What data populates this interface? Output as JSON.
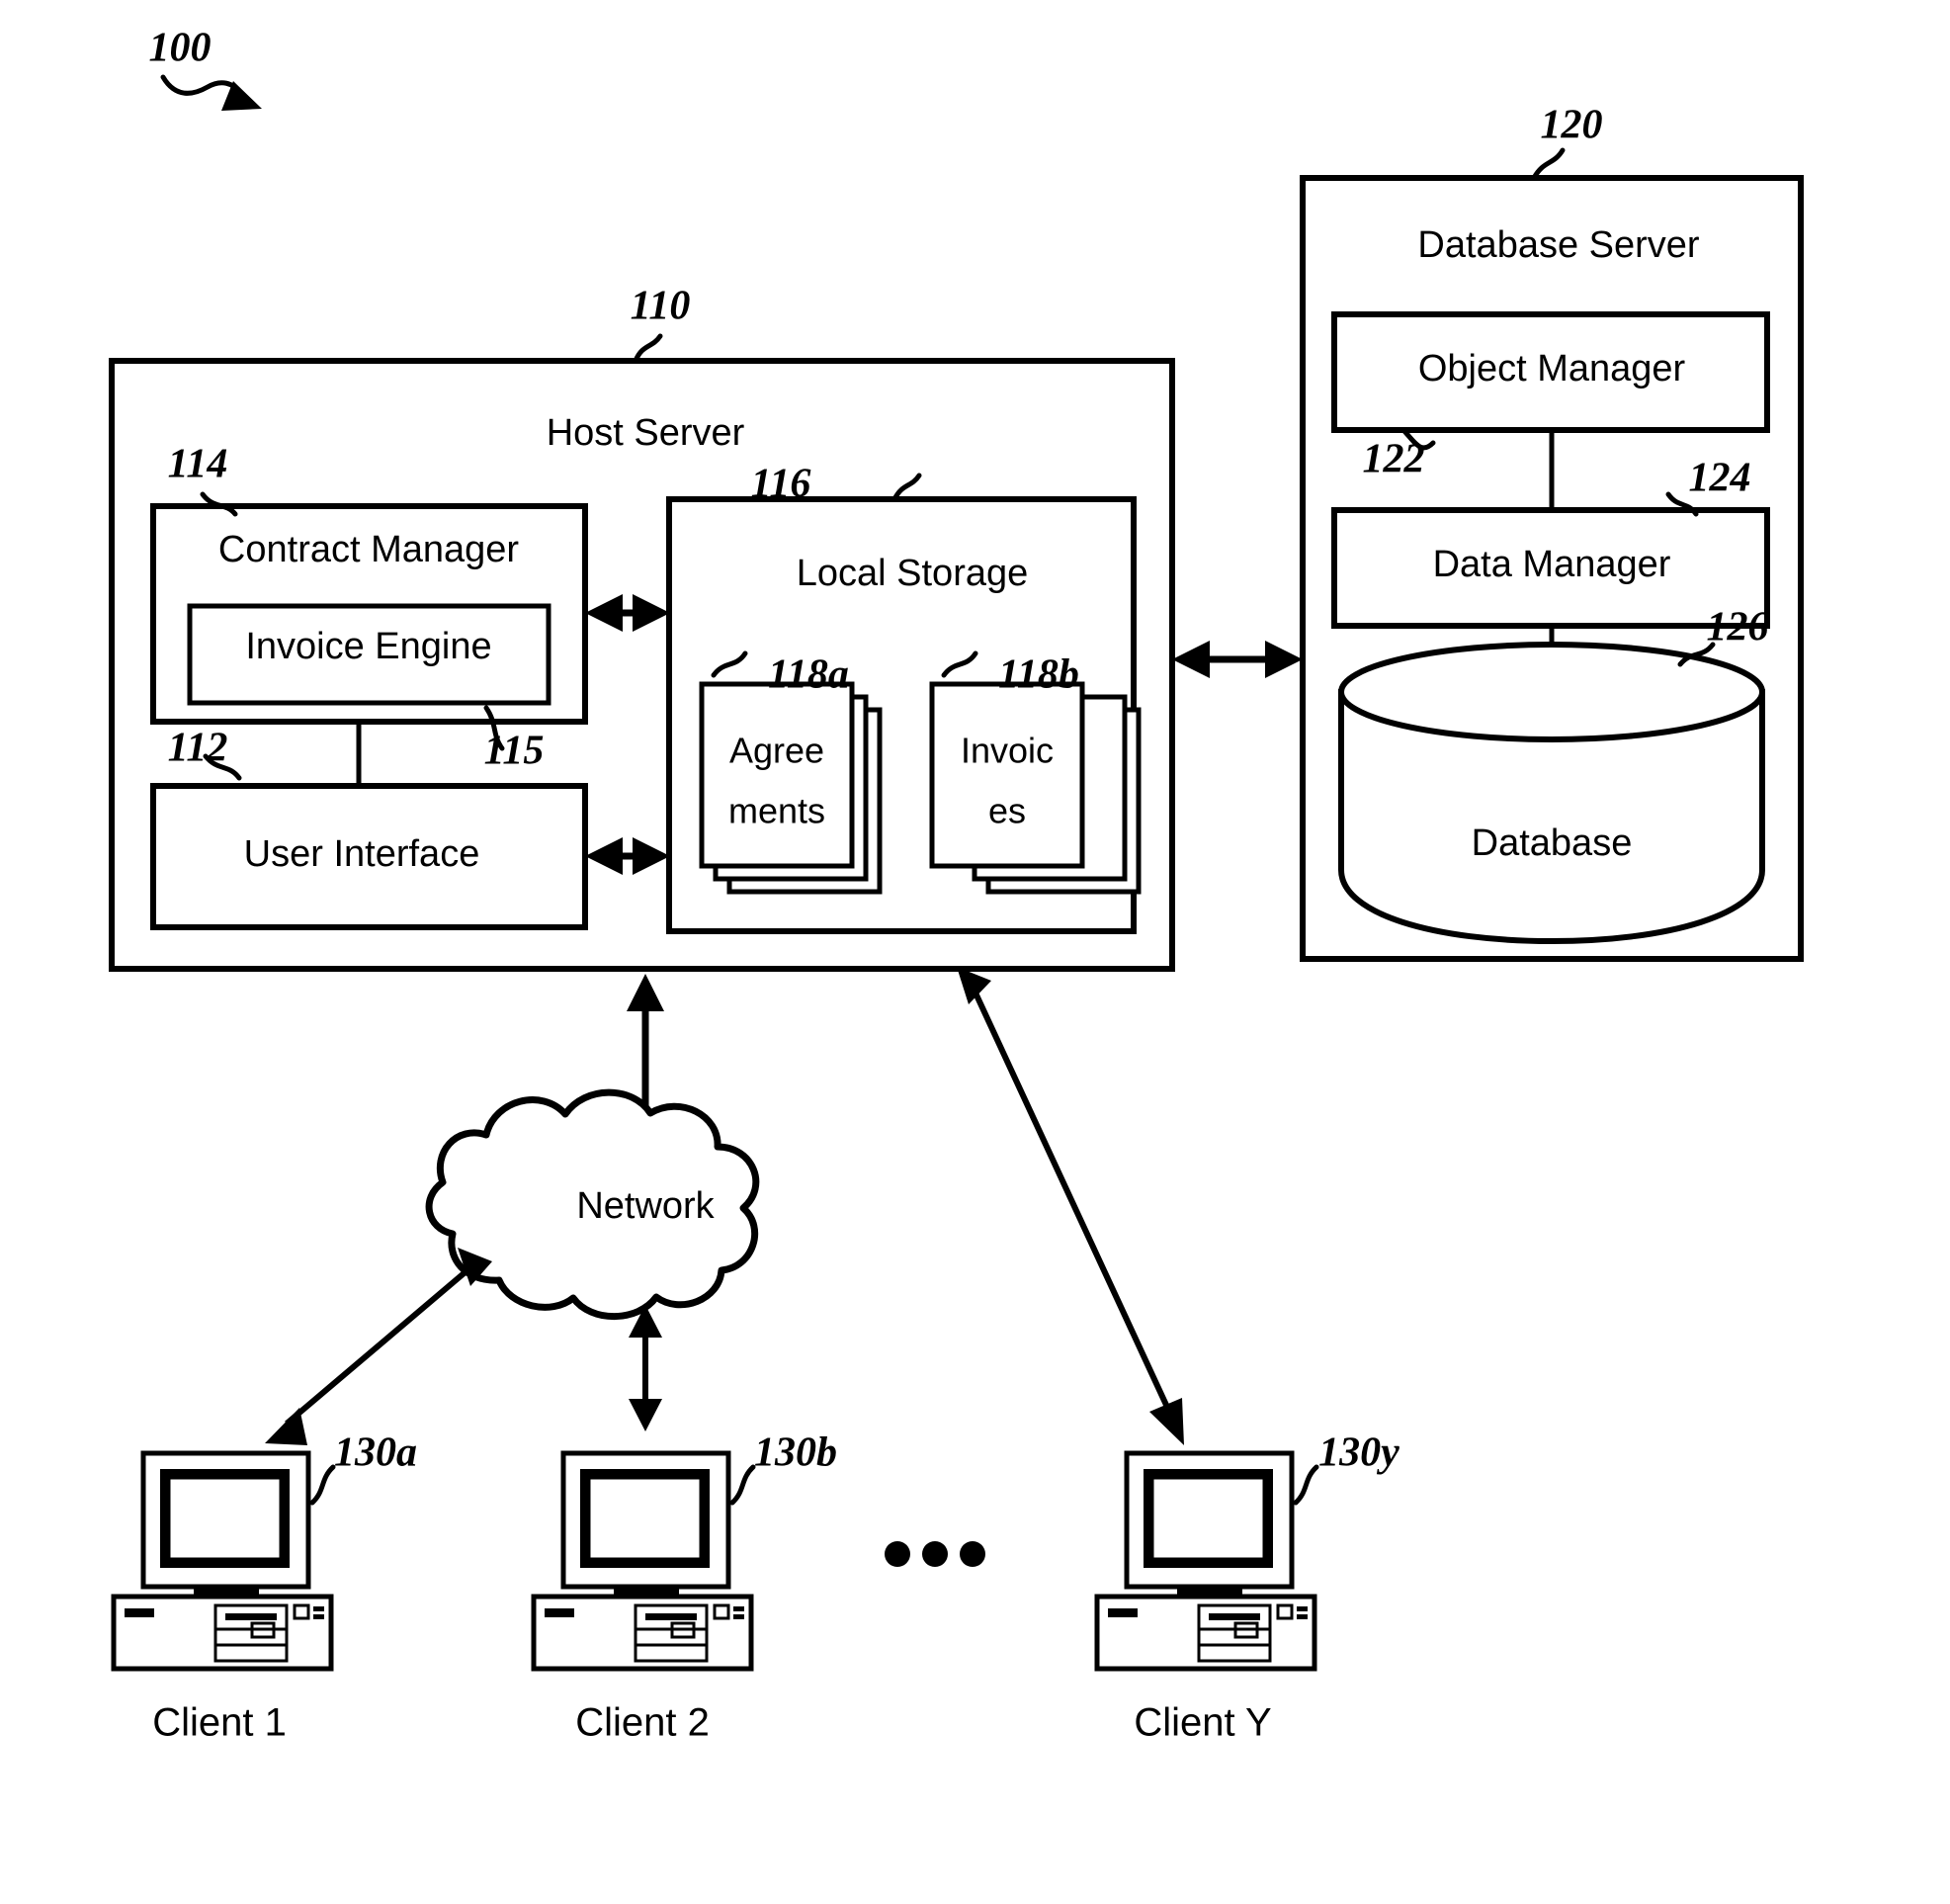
{
  "figure": {
    "reference_number": "100",
    "host_server": {
      "label": "Host Server",
      "ref": "110",
      "contract_manager": {
        "label": "Contract Manager",
        "ref": "114",
        "invoice_engine": {
          "label": "Invoice Engine",
          "ref": "115"
        }
      },
      "user_interface": {
        "label": "User Interface",
        "ref": "112"
      },
      "local_storage": {
        "label": "Local Storage",
        "ref": "116",
        "stacks": [
          {
            "label": "Agree\nments",
            "line1": "Agree",
            "line2": "ments",
            "ref": "118a"
          },
          {
            "label": "Invoic\nes",
            "line1": "Invoic",
            "line2": "es",
            "ref": "118b"
          }
        ]
      }
    },
    "database_server": {
      "label": "Database Server",
      "ref": "120",
      "object_manager": {
        "label": "Object Manager",
        "ref": "122"
      },
      "data_manager": {
        "label": "Data Manager",
        "ref": "124"
      },
      "database": {
        "label": "Database",
        "ref": "126"
      }
    },
    "network": {
      "label": "Network"
    },
    "clients": [
      {
        "label": "Client 1",
        "ref": "130a"
      },
      {
        "label": "Client 2",
        "ref": "130b"
      },
      {
        "label": "Client Y",
        "ref": "130y"
      }
    ],
    "ellipsis": "•••",
    "colors": {
      "stroke": "#000000",
      "background": "#ffffff"
    }
  }
}
